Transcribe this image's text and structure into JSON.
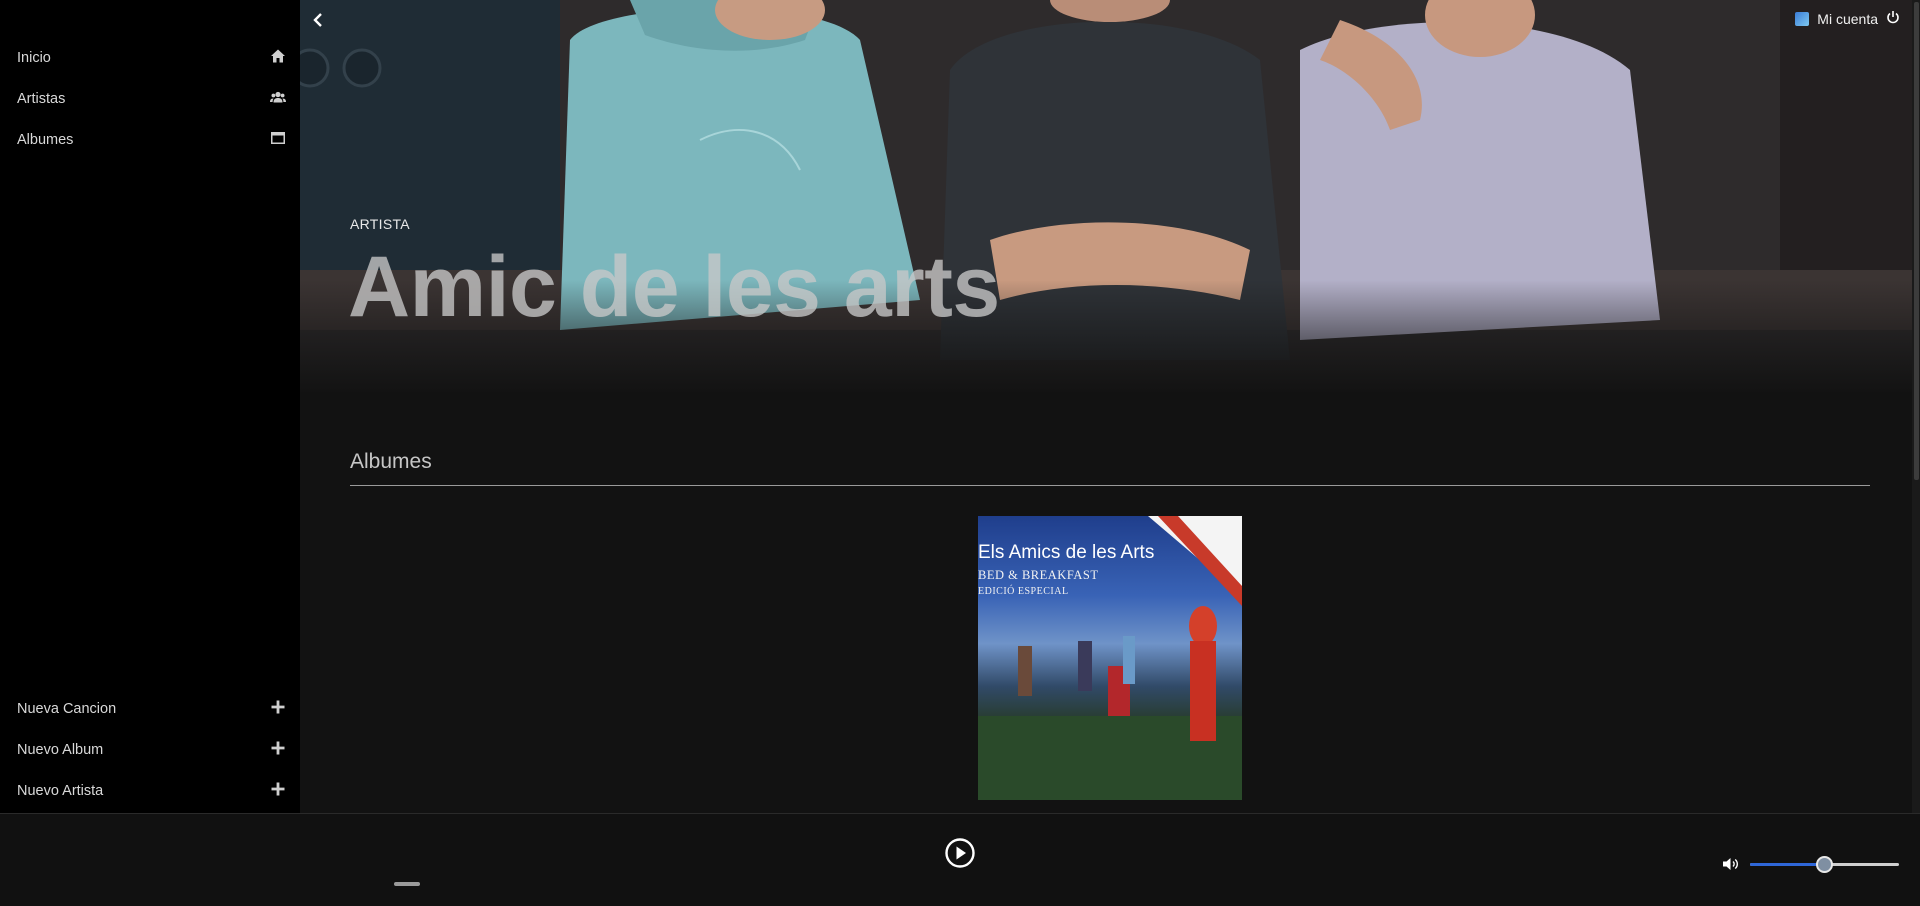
{
  "sidebar": {
    "top_items": [
      {
        "label": "Inicio",
        "icon": "home-icon"
      },
      {
        "label": "Artistas",
        "icon": "users-icon"
      },
      {
        "label": "Albumes",
        "icon": "window-icon"
      }
    ],
    "bottom_items": [
      {
        "label": "Nueva Cancion",
        "icon": "plus-icon"
      },
      {
        "label": "Nuevo Album",
        "icon": "plus-icon"
      },
      {
        "label": "Nuevo Artista",
        "icon": "plus-icon"
      }
    ]
  },
  "header": {
    "account_label": "Mi cuenta"
  },
  "artist": {
    "type_label": "ARTISTA",
    "name": "Amic de les arts"
  },
  "albums_section": {
    "title": "Albumes",
    "albums": [
      {
        "cover_title": "Els Amics de les Arts",
        "cover_subtitle": "BED & BREAKFAST",
        "cover_edition": "EDICIÓ ESPECIAL"
      }
    ]
  },
  "player": {
    "volume_fraction": 0.5,
    "accent_color": "#2f67d8"
  }
}
